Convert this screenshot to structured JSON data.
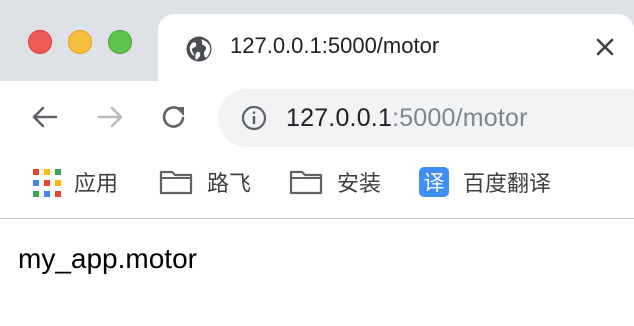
{
  "window": {
    "controls": {
      "close_color": "#ee5b56",
      "minimize_color": "#f7bf3b",
      "maximize_color": "#5fc34b"
    }
  },
  "tab": {
    "title": "127.0.0.1:5000/motor",
    "icon": "globe-icon",
    "close_icon": "close-icon"
  },
  "toolbar": {
    "back_icon": "arrow-left-icon",
    "forward_icon": "arrow-right-icon",
    "reload_icon": "reload-icon",
    "omnibox": {
      "info_icon": "info-icon",
      "url_host": "127.0.0.1",
      "url_rest": ":5000/motor"
    }
  },
  "bookmarks": {
    "items": [
      {
        "label": "应用",
        "icon": "apps-grid-icon"
      },
      {
        "label": "路飞",
        "icon": "folder-icon"
      },
      {
        "label": "安装",
        "icon": "folder-icon"
      },
      {
        "label": "百度翻译",
        "icon": "translate-icon",
        "badge_text": "译",
        "badge_color": "#3f8ef5"
      }
    ]
  },
  "page": {
    "body_text": "my_app.motor"
  }
}
